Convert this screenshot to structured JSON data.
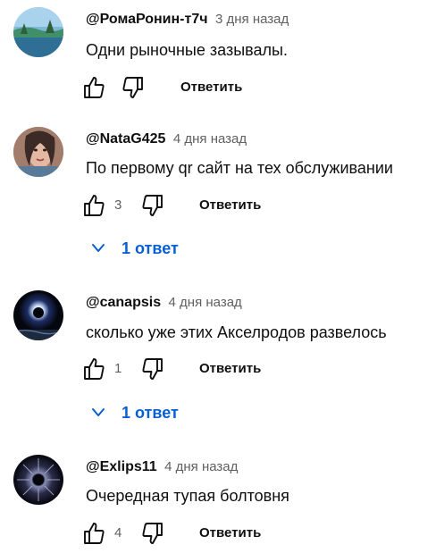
{
  "colors": {
    "link_blue": "#065fd4",
    "secondary_text": "#606060",
    "primary_text": "#0f0f0f"
  },
  "comments": [
    {
      "author": "@РомаРонин-т7ч",
      "time": "3 дня назад",
      "text": "Одни рыночные зазывалы.",
      "likes": "",
      "reply_label": "Ответить",
      "avatar_icon": "avatar-landscape-icon"
    },
    {
      "author": "@NataG425",
      "time": "4 дня назад",
      "text": "По первому qr сайт на тех обслуживании",
      "likes": "3",
      "reply_label": "Ответить",
      "replies_label": "1 ответ",
      "avatar_icon": "avatar-portrait-icon"
    },
    {
      "author": "@canapsis",
      "time": "4 дня назад",
      "text": "сколько уже этих Акселродов развелось",
      "likes": "1",
      "reply_label": "Ответить",
      "replies_label": "1 ответ",
      "avatar_icon": "avatar-eclipse-icon"
    },
    {
      "author": "@Exlips11",
      "time": "4 дня назад",
      "text": "Очередная тупая болтовня",
      "likes": "4",
      "reply_label": "Ответить",
      "avatar_icon": "avatar-starburst-icon"
    }
  ]
}
